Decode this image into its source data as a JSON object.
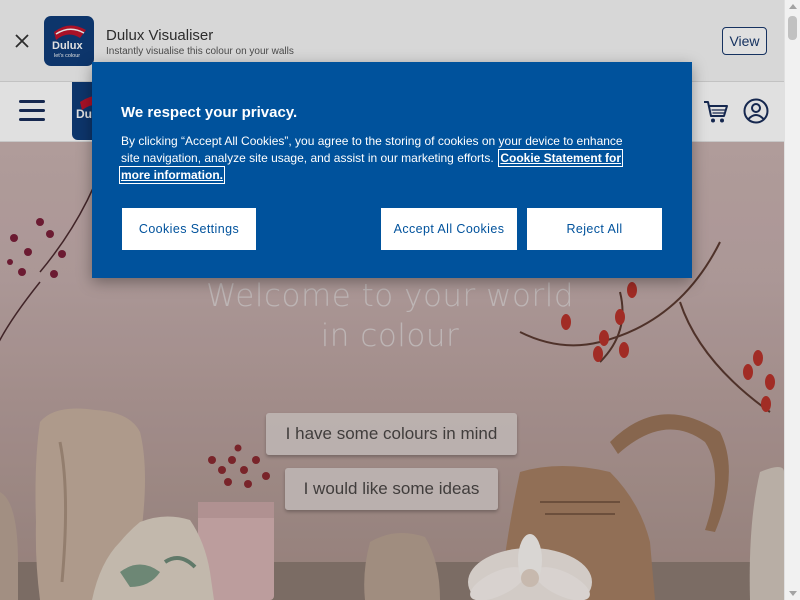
{
  "banner": {
    "app_name": "Dulux Visualiser",
    "subtitle": "Instantly visualise this colour on your walls",
    "view_label": "View",
    "logo_text": "Dulux",
    "logo_tagline": "let's colour"
  },
  "header": {
    "icons": [
      "menu-icon",
      "cart-icon",
      "account-icon"
    ]
  },
  "hero": {
    "title_line1": "Welcome to your world",
    "title_line2": "in colour",
    "button_1": "I have some colours in mind",
    "button_2": "I would like some ideas"
  },
  "cookie": {
    "title": "We respect your privacy.",
    "text": "By clicking “Accept All Cookies”, you agree to the storing of cookies on your device to enhance site navigation, analyze site usage, and assist in our marketing efforts.",
    "link": "Cookie Statement for more information.",
    "settings_label": "Cookies Settings",
    "accept_label": "Accept All Cookies",
    "reject_label": "Reject All"
  },
  "colors": {
    "modal_bg": "#00529c",
    "brand_navy": "#0f3d7a",
    "header_icon": "#1a2e5a"
  }
}
